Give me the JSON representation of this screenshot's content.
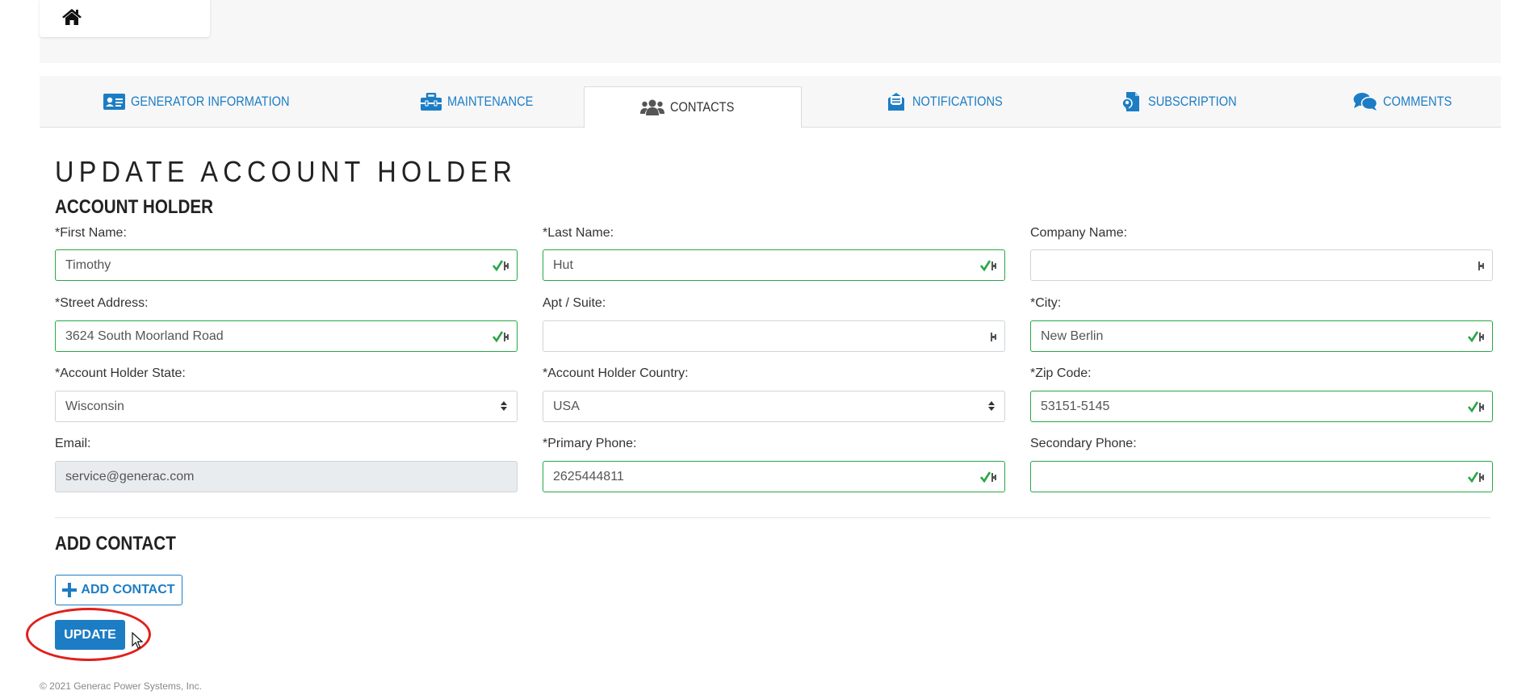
{
  "tabs": [
    {
      "label": "Generator Information",
      "icon": "id-card-icon",
      "active": false
    },
    {
      "label": "Maintenance",
      "icon": "toolbox-icon",
      "active": false
    },
    {
      "label": "Contacts",
      "icon": "users-icon",
      "active": true
    },
    {
      "label": "Notifications",
      "icon": "envelope-icon",
      "active": false
    },
    {
      "label": "Subscription",
      "icon": "file-location-icon",
      "active": false
    },
    {
      "label": "Comments",
      "icon": "comments-icon",
      "active": false
    }
  ],
  "page": {
    "title": "UPDATE ACCOUNT HOLDER",
    "account_section": "ACCOUNT HOLDER",
    "add_contact_section": "ADD CONTACT"
  },
  "form": {
    "first_name": {
      "label": "*First Name:",
      "value": "Timothy"
    },
    "last_name": {
      "label": "*Last Name:",
      "value": "Hut"
    },
    "company_name": {
      "label": "Company Name:",
      "value": ""
    },
    "street_address": {
      "label": "*Street Address:",
      "value": "3624 South Moorland Road"
    },
    "apt_suite": {
      "label": "Apt / Suite:",
      "value": ""
    },
    "city": {
      "label": "*City:",
      "value": "New Berlin"
    },
    "state": {
      "label": "*Account Holder State:",
      "value": "Wisconsin"
    },
    "country": {
      "label": "*Account Holder Country:",
      "value": "USA"
    },
    "zip": {
      "label": "*Zip Code:",
      "value": "53151-5145"
    },
    "email": {
      "label": "Email:",
      "value": "service@generac.com"
    },
    "primary_phone": {
      "label": "*Primary Phone:",
      "value": "2625444811"
    },
    "secondary_phone": {
      "label": "Secondary Phone:",
      "value": ""
    }
  },
  "buttons": {
    "add_contact": "ADD CONTACT",
    "update": "UPDATE"
  },
  "footer": "© 2021 Generac Power Systems, Inc.",
  "colors": {
    "accent": "#1c7dc4",
    "valid": "#28a745",
    "annotation": "#e0201b"
  }
}
